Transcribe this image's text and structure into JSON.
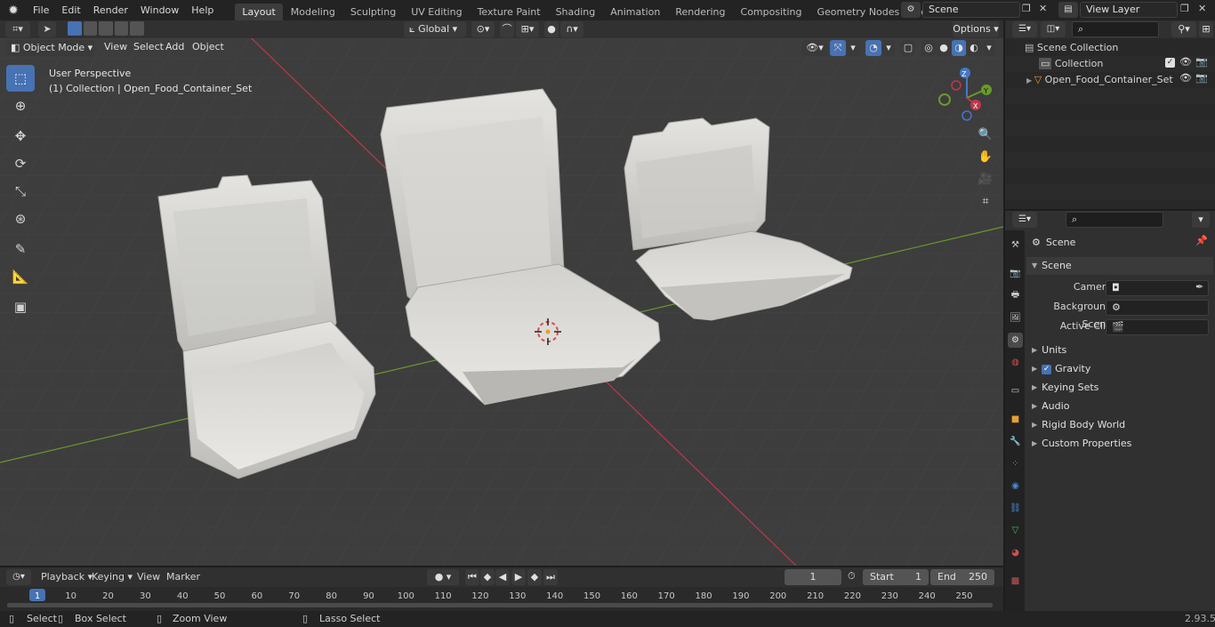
{
  "topbar": {
    "menus": [
      "File",
      "Edit",
      "Render",
      "Window",
      "Help"
    ],
    "workspaces": [
      "Layout",
      "Modeling",
      "Sculpting",
      "UV Editing",
      "Texture Paint",
      "Shading",
      "Animation",
      "Rendering",
      "Compositing",
      "Geometry Nodes",
      "Scripting"
    ],
    "active_workspace": "Layout",
    "scene": "Scene",
    "view_layer": "View Layer"
  },
  "viewport": {
    "mode": "Object Mode",
    "menus": [
      "View",
      "Select",
      "Add",
      "Object"
    ],
    "orientation": "Global",
    "options": "Options",
    "perspective": "User Perspective",
    "collection_info": "(1) Collection | Open_Food_Container_Set",
    "gizmo": {
      "x": "X",
      "y": "Y",
      "z": "Z"
    }
  },
  "outliner": {
    "root": "Scene Collection",
    "items": [
      {
        "label": "Collection"
      },
      {
        "label": "Open_Food_Container_Set"
      }
    ]
  },
  "properties": {
    "header": "Scene",
    "panel": "Scene",
    "fields": [
      {
        "label": "Camera"
      },
      {
        "label": "Background Scene"
      },
      {
        "label": "Active Clip"
      }
    ],
    "sections": [
      "Units",
      "Gravity",
      "Keying Sets",
      "Audio",
      "Rigid Body World",
      "Custom Properties"
    ],
    "gravity_checked": true
  },
  "timeline": {
    "menus": [
      "Playback",
      "Keying",
      "View",
      "Marker"
    ],
    "current_frame": "1",
    "start_label": "Start",
    "start": "1",
    "end_label": "End",
    "end": "250",
    "ruler": [
      "1",
      "10",
      "20",
      "30",
      "40",
      "50",
      "60",
      "70",
      "80",
      "90",
      "100",
      "110",
      "120",
      "130",
      "140",
      "150",
      "160",
      "170",
      "180",
      "190",
      "200",
      "210",
      "220",
      "230",
      "240",
      "250"
    ]
  },
  "status": {
    "select": "Select",
    "box_select": "Box Select",
    "zoom_view": "Zoom View",
    "lasso_select": "Lasso Select",
    "version": "2.93.5"
  },
  "colors": {
    "accent": "#4772b3",
    "x_axis": "#c0374a",
    "y_axis": "#6a9a2a",
    "viewport_bg": "#3d3d3d"
  }
}
